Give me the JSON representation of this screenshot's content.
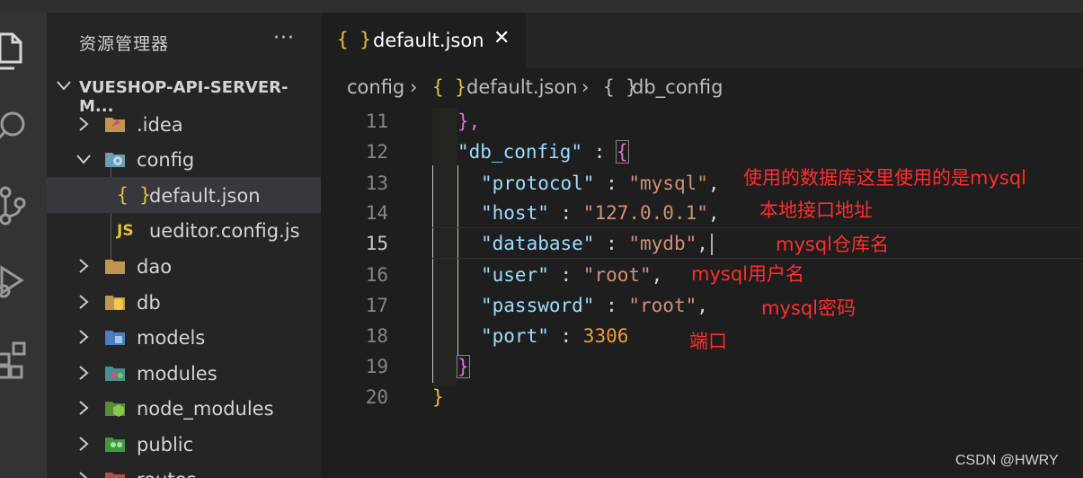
{
  "explorer": {
    "title": "资源管理器",
    "more": "···",
    "project": "VUESHOP-API-SERVER-M...",
    "items": [
      {
        "label": ".idea"
      },
      {
        "label": "config"
      },
      {
        "label": "default.json"
      },
      {
        "label": "ueditor.config.js"
      },
      {
        "label": "dao"
      },
      {
        "label": "db"
      },
      {
        "label": "models"
      },
      {
        "label": "modules"
      },
      {
        "label": "node_modules"
      },
      {
        "label": "public"
      },
      {
        "label": "routes"
      }
    ]
  },
  "tab": {
    "braces": "{ }",
    "label": "default.json",
    "close": "✕"
  },
  "breadcrumb": {
    "b0": "config",
    "sep": "›",
    "b1_icon": "{ }",
    "b1": "default.json",
    "b2_icon": "{ }",
    "b2": "db_config"
  },
  "editor": {
    "lines": [
      "11",
      "12",
      "13",
      "14",
      "15",
      "16",
      "17",
      "18",
      "19",
      "20"
    ],
    "code": {
      "l11": "},",
      "l12_key": "\"db_config\"",
      "l12_colon": " : ",
      "l12_brace": "{",
      "l13_key": "\"protocol\"",
      "l13_val": "\"mysql\"",
      "l14_key": "\"host\"",
      "l14_val": "\"127.0.0.1\"",
      "l15_key": "\"database\"",
      "l15_val": "\"mydb\"",
      "l16_key": "\"user\"",
      "l16_val": "\"root\"",
      "l17_key": "\"password\"",
      "l17_val": "\"root\"",
      "l18_key": "\"port\"",
      "l18_val": "3306",
      "l19": "}",
      "l20": "}",
      "colon": " : ",
      "comma": ","
    },
    "annotations": {
      "protocol": "使用的数据库这里使用的是mysql",
      "host": "本地接口地址",
      "database": "mysql仓库名",
      "user": "mysql用户名",
      "password": "mysql密码",
      "port": "端口"
    }
  },
  "watermark": "CSDN @HWRY",
  "icons": {
    "activity": [
      "files-icon",
      "search-icon",
      "source-control-icon",
      "run-debug-icon",
      "extensions-icon"
    ]
  }
}
